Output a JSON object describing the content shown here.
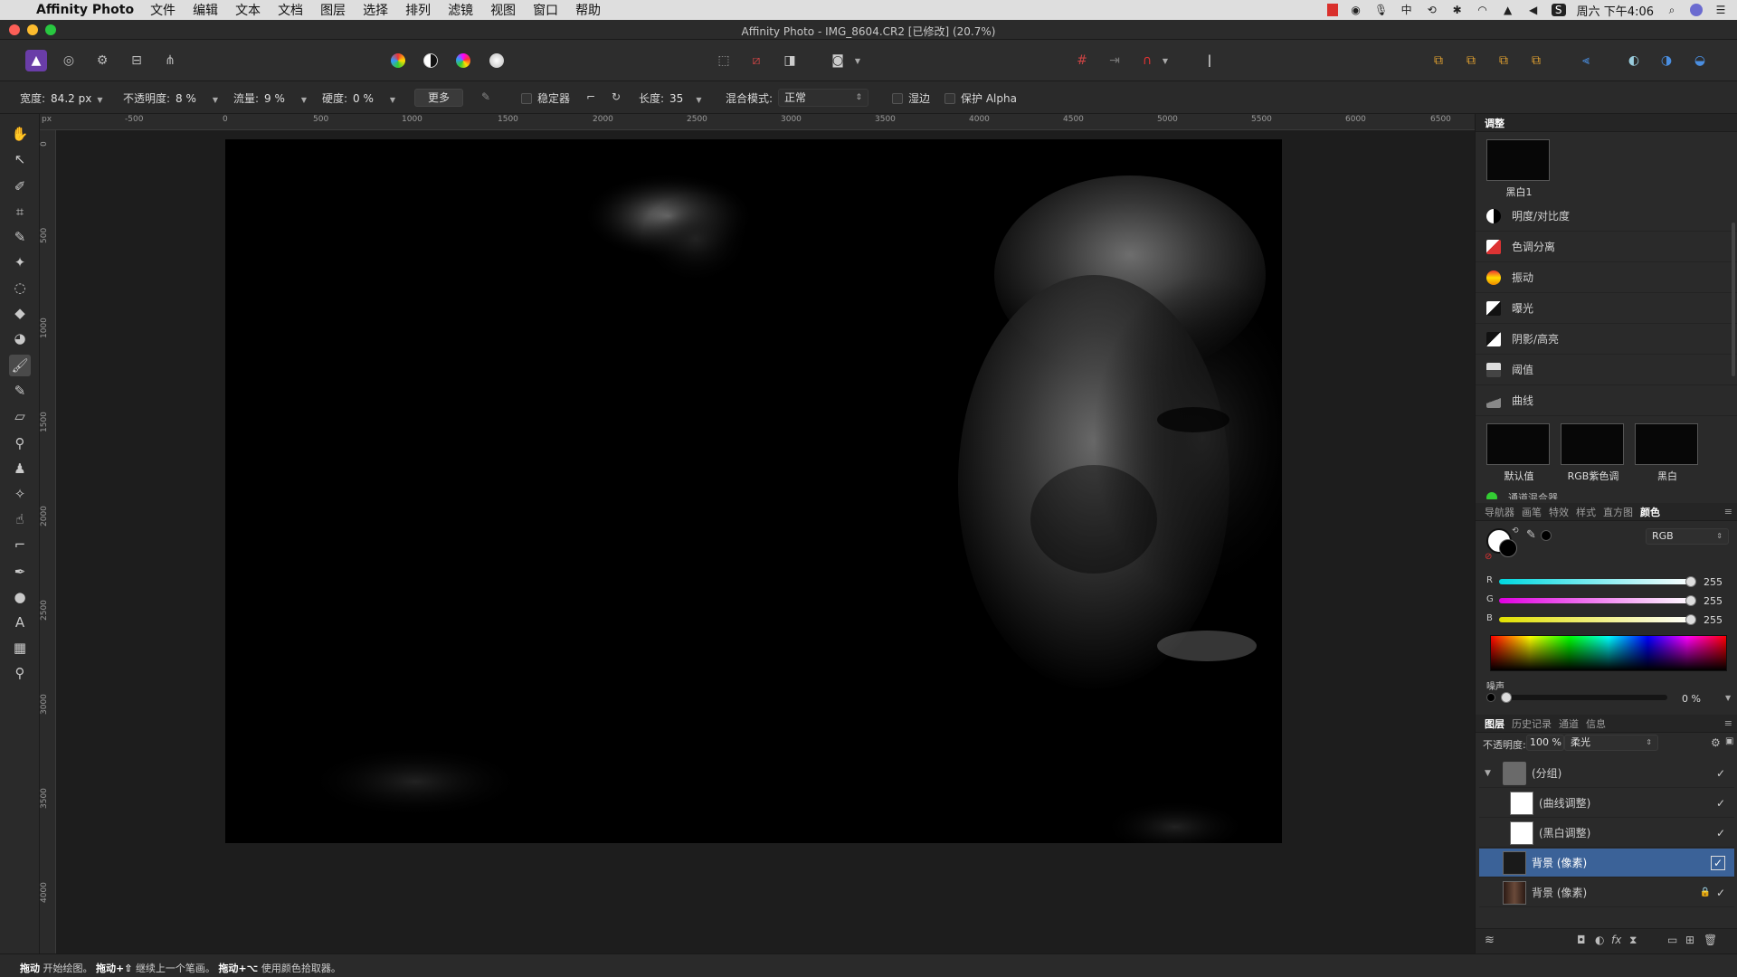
{
  "menubar": {
    "app_name": "Affinity Photo",
    "items": [
      "文件",
      "编辑",
      "文本",
      "文档",
      "图层",
      "选择",
      "排列",
      "滤镜",
      "视图",
      "窗口",
      "帮助"
    ],
    "ime": "中",
    "clock": "周六 下午4:06"
  },
  "window": {
    "title": "Affinity Photo - IMG_8604.CR2 [已修改] (20.7%)"
  },
  "context_toolbar": {
    "width_label": "宽度:",
    "width_value": "84.2 px",
    "opacity_label": "不透明度:",
    "opacity_value": "8 %",
    "flow_label": "流量:",
    "flow_value": "9 %",
    "hardness_label": "硬度:",
    "hardness_value": "0 %",
    "more_label": "更多",
    "stabilizer_label": "稳定器",
    "length_label": "长度:",
    "length_value": "35",
    "blend_mode_label": "混合模式:",
    "blend_mode_value": "正常",
    "wet_edges_label": "湿边",
    "protect_alpha_label": "保护 Alpha"
  },
  "ruler": {
    "unit": "px",
    "top_ticks": [
      "-500",
      "0",
      "500",
      "1000",
      "1500",
      "2000",
      "2500",
      "3000",
      "3500",
      "4000",
      "4500",
      "5000",
      "5500",
      "6000",
      "6500"
    ],
    "left_ticks": [
      "0",
      "500",
      "1000",
      "1500",
      "2000",
      "2500",
      "3000",
      "3500",
      "4000"
    ]
  },
  "adjustments_panel": {
    "title": "调整",
    "preset_top_label": "黑白1",
    "items": [
      "明度/对比度",
      "色调分离",
      "振动",
      "曝光",
      "阴影/高亮",
      "阈值",
      "曲线"
    ],
    "presets": [
      "默认值",
      "RGB紫色调",
      "黑白"
    ],
    "partial_next_item": "通道混合器"
  },
  "color_panel": {
    "tabs": [
      "导航器",
      "画笔",
      "特效",
      "样式",
      "直方图",
      "颜色"
    ],
    "active_tab": "颜色",
    "mode": "RGB",
    "channels": [
      {
        "label": "R",
        "value": "255"
      },
      {
        "label": "G",
        "value": "255"
      },
      {
        "label": "B",
        "value": "255"
      }
    ],
    "noise_label": "噪声",
    "noise_value": "0 %"
  },
  "layers_panel": {
    "tabs": [
      "图层",
      "历史记录",
      "通道",
      "信息"
    ],
    "active_tab": "图层",
    "opacity_label": "不透明度:",
    "opacity_value": "100 %",
    "blend_value": "柔光",
    "layers": [
      {
        "name": "(分组)",
        "selected": false,
        "check": "✓"
      },
      {
        "name": "(曲线调整)",
        "selected": false,
        "check": "✓"
      },
      {
        "name": "(黑白调整)",
        "selected": false,
        "check": "✓"
      },
      {
        "name": "背景 (像素)",
        "selected": true,
        "check": "✓"
      },
      {
        "name": "背景 (像素)",
        "selected": false,
        "check": "✓"
      }
    ]
  },
  "statusbar": {
    "k1": "拖动",
    "t1": "开始绘图。",
    "k2": "拖动+⇧",
    "t2": "继续上一个笔画。",
    "k3": "拖动+⌥",
    "t3": "使用颜色拾取器。"
  },
  "colors": {
    "selection": "#3b6298",
    "accent_red": "#d9302c"
  }
}
